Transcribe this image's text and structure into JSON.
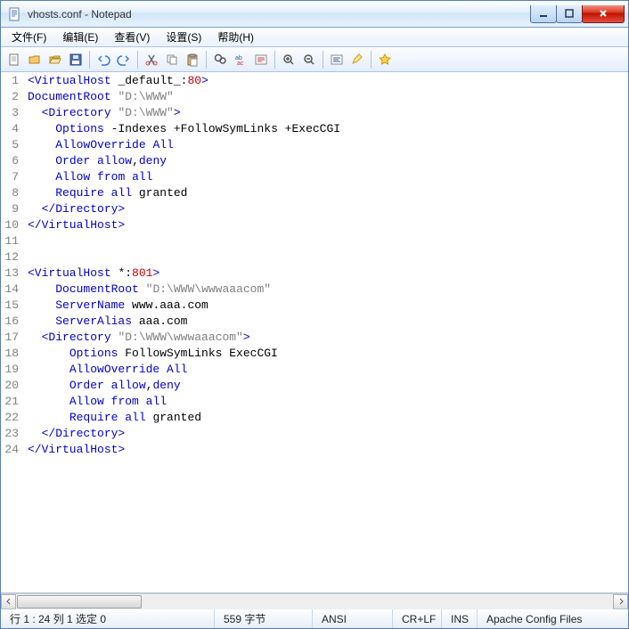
{
  "window": {
    "title": "vhosts.conf - Notepad"
  },
  "menu": {
    "file": "文件(F)",
    "edit": "编辑(E)",
    "view": "查看(V)",
    "settings": "设置(S)",
    "help": "帮助(H)"
  },
  "toolbar_icons": [
    "new",
    "open",
    "open-folder",
    "save",
    "sep",
    "undo",
    "redo",
    "sep",
    "cut",
    "copy",
    "paste",
    "sep",
    "find",
    "replace",
    "goto",
    "sep",
    "zoom-in",
    "zoom-out",
    "sep",
    "wrap",
    "highlight",
    "sep",
    "star"
  ],
  "code_lines": [
    {
      "n": 1,
      "html": "<span class='tag'>&lt;VirtualHost</span> <span class='plain'>_default_:</span><span class='attr'>80</span><span class='tag'>&gt;</span>"
    },
    {
      "n": 2,
      "html": "<span class='kw'>DocumentRoot</span> <span class='str'>\"D:\\WWW\"</span>"
    },
    {
      "n": 3,
      "html": "  <span class='tag'>&lt;Directory</span> <span class='str'>\"D:\\WWW\"</span><span class='tag'>&gt;</span>"
    },
    {
      "n": 4,
      "html": "    <span class='kw'>Options</span> <span class='plain'>-Indexes +FollowSymLinks +ExecCGI</span>"
    },
    {
      "n": 5,
      "html": "    <span class='kw'>AllowOverride</span> <span class='kw'>All</span>"
    },
    {
      "n": 6,
      "html": "    <span class='kw'>Order</span> <span class='kw'>allow</span><span class='plain'>,</span><span class='kw'>deny</span>"
    },
    {
      "n": 7,
      "html": "    <span class='kw'>Allow</span> <span class='kw'>from</span> <span class='kw'>all</span>"
    },
    {
      "n": 8,
      "html": "    <span class='kw'>Require</span> <span class='kw'>all</span> <span class='plain'>granted</span>"
    },
    {
      "n": 9,
      "html": "  <span class='tag'>&lt;/Directory&gt;</span>"
    },
    {
      "n": 10,
      "html": "<span class='tag'>&lt;/VirtualHost&gt;</span>"
    },
    {
      "n": 11,
      "html": ""
    },
    {
      "n": 12,
      "html": ""
    },
    {
      "n": 13,
      "html": "<span class='tag'>&lt;VirtualHost</span> <span class='plain'>*:</span><span class='attr'>801</span><span class='tag'>&gt;</span>"
    },
    {
      "n": 14,
      "html": "    <span class='kw'>DocumentRoot</span> <span class='str'>\"D:\\WWW\\wwwaaacom\"</span>"
    },
    {
      "n": 15,
      "html": "    <span class='kw'>ServerName</span> <span class='plain'>www.aaa.com</span>"
    },
    {
      "n": 16,
      "html": "    <span class='kw'>ServerAlias</span> <span class='plain'>aaa.com</span>"
    },
    {
      "n": 17,
      "html": "  <span class='tag'>&lt;Directory</span> <span class='str'>\"D:\\WWW\\wwwaaacom\"</span><span class='tag'>&gt;</span>"
    },
    {
      "n": 18,
      "html": "      <span class='kw'>Options</span> <span class='plain'>FollowSymLinks ExecCGI</span>"
    },
    {
      "n": 19,
      "html": "      <span class='kw'>AllowOverride</span> <span class='kw'>All</span>"
    },
    {
      "n": 20,
      "html": "      <span class='kw'>Order</span> <span class='kw'>allow</span><span class='plain'>,</span><span class='kw'>deny</span>"
    },
    {
      "n": 21,
      "html": "      <span class='kw'>Allow</span> <span class='kw'>from</span> <span class='kw'>all</span>"
    },
    {
      "n": 22,
      "html": "      <span class='kw'>Require</span> <span class='kw'>all</span> <span class='plain'>granted</span>"
    },
    {
      "n": 23,
      "html": "  <span class='tag'>&lt;/Directory&gt;</span>"
    },
    {
      "n": 24,
      "html": "<span class='tag'>&lt;/VirtualHost&gt;</span>"
    }
  ],
  "status": {
    "pos": "行 1 : 24  列 1  选定 0",
    "bytes": "559 字节",
    "encoding": "ANSI",
    "eol": "CR+LF",
    "ins": "INS",
    "type": "Apache Config Files"
  }
}
